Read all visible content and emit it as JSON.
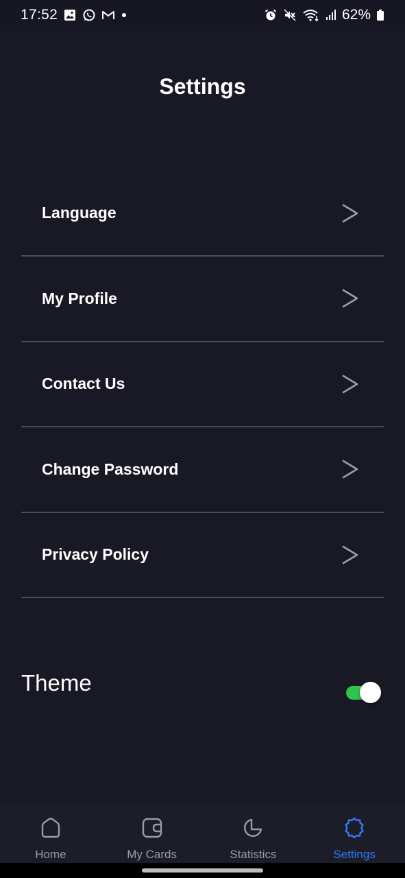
{
  "status_bar": {
    "time": "17:52",
    "battery": "62%",
    "left_icons": [
      "gallery-icon",
      "whatsapp-icon",
      "gmail-icon",
      "dot-icon"
    ],
    "right_icons": [
      "alarm-icon",
      "mute-icon",
      "wifi-icon",
      "signal-icon",
      "battery-icon"
    ]
  },
  "page": {
    "title": "Settings"
  },
  "menu": {
    "items": [
      {
        "label": "Language",
        "icon": "chevron-right-icon"
      },
      {
        "label": "My Profile",
        "icon": "chevron-right-icon"
      },
      {
        "label": "Contact Us",
        "icon": "chevron-right-icon"
      },
      {
        "label": "Change Password",
        "icon": "chevron-right-icon"
      },
      {
        "label": "Privacy Policy",
        "icon": "chevron-right-icon"
      }
    ]
  },
  "theme": {
    "label": "Theme",
    "toggle_on": true,
    "toggle_color": "#2fc44c"
  },
  "bottom_nav": {
    "items": [
      {
        "label": "Home",
        "icon": "home-icon",
        "active": false
      },
      {
        "label": "My Cards",
        "icon": "wallet-icon",
        "active": false
      },
      {
        "label": "Statistics",
        "icon": "pie-chart-icon",
        "active": false
      },
      {
        "label": "Settings",
        "icon": "gear-icon",
        "active": true
      }
    ],
    "active_color": "#2f7cf6",
    "inactive_color": "#9a9ba3"
  },
  "colors": {
    "background": "#181925",
    "divider": "#4a4c57"
  }
}
